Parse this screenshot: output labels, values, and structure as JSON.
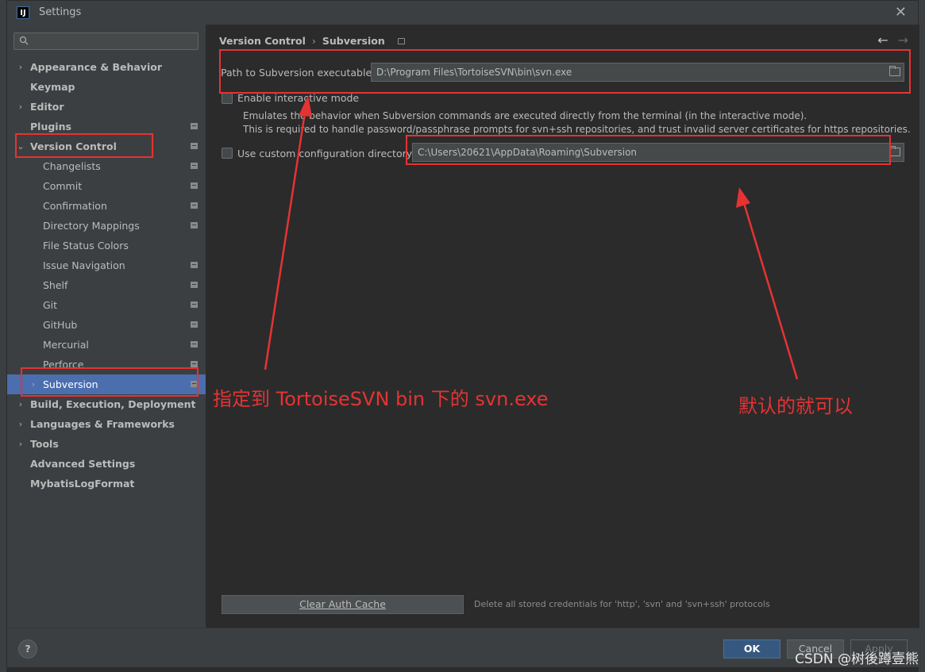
{
  "window": {
    "title": "Settings",
    "app_icon": "IJ"
  },
  "sidebar": {
    "search_placeholder": "Q-",
    "items": [
      {
        "label": "Appearance & Behavior",
        "level": "top",
        "expandable": true,
        "expanded": false,
        "project": false
      },
      {
        "label": "Keymap",
        "level": "top",
        "expandable": false,
        "project": false
      },
      {
        "label": "Editor",
        "level": "top",
        "expandable": true,
        "expanded": false,
        "project": false
      },
      {
        "label": "Plugins",
        "level": "top",
        "expandable": false,
        "project": true
      },
      {
        "label": "Version Control",
        "level": "top",
        "expandable": true,
        "expanded": true,
        "project": true
      },
      {
        "label": "Changelists",
        "level": "child",
        "project": true
      },
      {
        "label": "Commit",
        "level": "child",
        "project": true
      },
      {
        "label": "Confirmation",
        "level": "child",
        "project": true
      },
      {
        "label": "Directory Mappings",
        "level": "child",
        "project": true
      },
      {
        "label": "File Status Colors",
        "level": "child",
        "project": false
      },
      {
        "label": "Issue Navigation",
        "level": "child",
        "project": true
      },
      {
        "label": "Shelf",
        "level": "child",
        "project": true
      },
      {
        "label": "Git",
        "level": "child",
        "project": true
      },
      {
        "label": "GitHub",
        "level": "child",
        "project": true
      },
      {
        "label": "Mercurial",
        "level": "child",
        "project": true
      },
      {
        "label": "Perforce",
        "level": "child",
        "project": true
      },
      {
        "label": "Subversion",
        "level": "child",
        "expandable": true,
        "selected": true,
        "project": true
      },
      {
        "label": "Build, Execution, Deployment",
        "level": "top",
        "expandable": true,
        "project": false
      },
      {
        "label": "Languages & Frameworks",
        "level": "top",
        "expandable": true,
        "project": false
      },
      {
        "label": "Tools",
        "level": "top",
        "expandable": true,
        "project": false
      },
      {
        "label": "Advanced Settings",
        "level": "top",
        "expandable": false,
        "project": false
      },
      {
        "label": "MybatisLogFormat",
        "level": "top",
        "expandable": false,
        "project": false
      }
    ]
  },
  "breadcrumb": {
    "parent": "Version Control",
    "separator": "›",
    "current": "Subversion"
  },
  "svn": {
    "path_label": "Path to Subversion executable:",
    "path_value": "D:\\Program Files\\TortoiseSVN\\bin\\svn.exe",
    "interactive_label": "Enable interactive mode",
    "interactive_checked": false,
    "interactive_desc_1": "Emulates the behavior when Subversion commands are executed directly from the terminal (in the interactive mode).",
    "interactive_desc_2": "This is required to handle password/passphrase prompts for svn+ssh repositories, and trust invalid server certificates for https repositories.",
    "custom_dir_label": "Use custom configuration directory:",
    "custom_dir_checked": false,
    "custom_dir_value": "C:\\Users\\20621\\AppData\\Roaming\\Subversion",
    "clear_cache_label": "Clear Auth Cache",
    "clear_cache_desc": "Delete all stored credentials for 'http', 'svn' and 'svn+ssh' protocols"
  },
  "footer": {
    "help": "?",
    "ok": "OK",
    "cancel": "Cancel",
    "apply": "Apply"
  },
  "annotations": {
    "note_path": "指定到 TortoiseSVN bin 下的  svn.exe",
    "note_default": "默认的就可以",
    "watermark": "CSDN @树後蹲壹熊",
    "color": "#e53333"
  }
}
